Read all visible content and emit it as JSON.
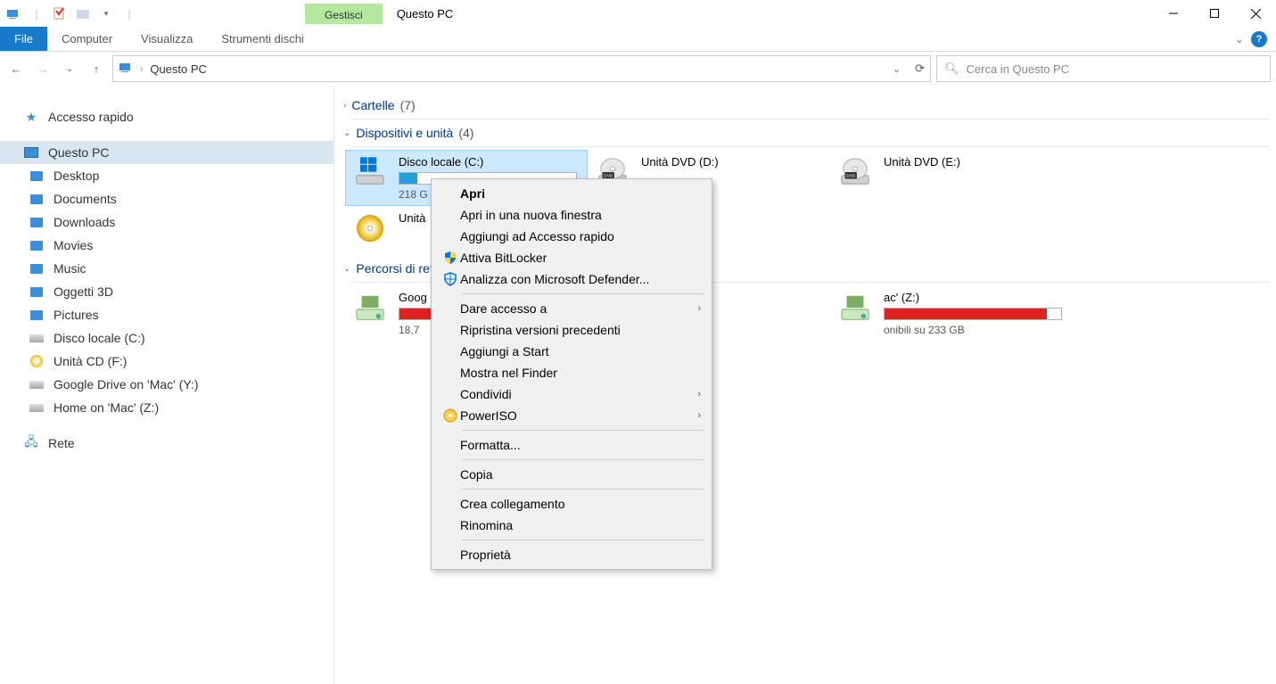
{
  "title": "Questo PC",
  "manage_tab": "Gestisci",
  "ribbon": {
    "file": "File",
    "computer": "Computer",
    "view": "Visualizza",
    "disk_tools": "Strumenti dischi"
  },
  "address": {
    "crumb": "Questo PC"
  },
  "search": {
    "placeholder": "Cerca in Questo PC"
  },
  "sidebar": {
    "quick_access": "Accesso rapido",
    "this_pc": "Questo PC",
    "items": [
      "Desktop",
      "Documents",
      "Downloads",
      "Movies",
      "Music",
      "Oggetti 3D",
      "Pictures",
      "Disco locale (C:)",
      "Unità CD (F:)",
      "Google Drive on 'Mac' (Y:)",
      "Home on 'Mac' (Z:)"
    ],
    "network": "Rete"
  },
  "sections": {
    "folders": {
      "label": "Cartelle",
      "count": "(7)"
    },
    "devices": {
      "label": "Dispositivi e unità",
      "count": "(4)"
    },
    "netloc": {
      "label": "Percorsi di rete",
      "count": ""
    }
  },
  "drives": [
    {
      "name": "Disco locale (C:)",
      "free": "218 G",
      "fill_pct": 10,
      "color": "blue",
      "selected": true,
      "kind": "hdd-win"
    },
    {
      "name": "Unità DVD (D:)",
      "free": "",
      "fill_pct": 0,
      "color": "",
      "selected": false,
      "kind": "dvd"
    },
    {
      "name": "Unità DVD (E:)",
      "free": "",
      "fill_pct": 0,
      "color": "",
      "selected": false,
      "kind": "dvd"
    },
    {
      "name": "Unità",
      "free": "",
      "fill_pct": 0,
      "color": "",
      "selected": false,
      "kind": "cd"
    }
  ],
  "net_drives": [
    {
      "name": "Goog",
      "free": "18,7",
      "fill_pct": 25,
      "color": "red"
    },
    {
      "name": "ac' (Z:)",
      "free": "onibili su 233 GB",
      "fill_pct": 92,
      "color": "red"
    }
  ],
  "context_menu": {
    "groups": [
      [
        {
          "label": "Apri",
          "bold": true,
          "icon": "",
          "arrow": false
        },
        {
          "label": "Apri in una nuova finestra",
          "bold": false,
          "icon": "",
          "arrow": false
        },
        {
          "label": "Aggiungi ad Accesso rapido",
          "bold": false,
          "icon": "",
          "arrow": false
        },
        {
          "label": "Attiva BitLocker",
          "bold": false,
          "icon": "shield-blue-yellow",
          "arrow": false
        },
        {
          "label": "Analizza con Microsoft Defender...",
          "bold": false,
          "icon": "shield-blue",
          "arrow": false
        }
      ],
      [
        {
          "label": "Dare accesso a",
          "bold": false,
          "icon": "",
          "arrow": true
        },
        {
          "label": "Ripristina versioni precedenti",
          "bold": false,
          "icon": "",
          "arrow": false
        },
        {
          "label": "Aggiungi a Start",
          "bold": false,
          "icon": "",
          "arrow": false
        },
        {
          "label": "Mostra nel Finder",
          "bold": false,
          "icon": "",
          "arrow": false
        },
        {
          "label": "Condividi",
          "bold": false,
          "icon": "",
          "arrow": true
        },
        {
          "label": "PowerISO",
          "bold": false,
          "icon": "poweriso",
          "arrow": true
        }
      ],
      [
        {
          "label": "Formatta...",
          "bold": false,
          "icon": "",
          "arrow": false
        }
      ],
      [
        {
          "label": "Copia",
          "bold": false,
          "icon": "",
          "arrow": false
        }
      ],
      [
        {
          "label": "Crea collegamento",
          "bold": false,
          "icon": "",
          "arrow": false
        },
        {
          "label": "Rinomina",
          "bold": false,
          "icon": "",
          "arrow": false
        }
      ],
      [
        {
          "label": "Proprietà",
          "bold": false,
          "icon": "",
          "arrow": false
        }
      ]
    ]
  }
}
